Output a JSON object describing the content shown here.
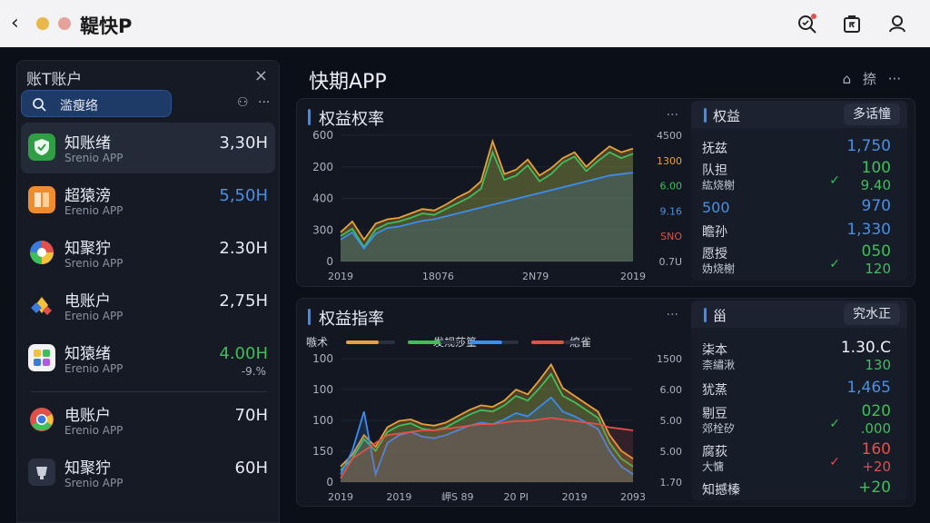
{
  "titlebar": {
    "back_glyph": "‹",
    "title": "鞮快P",
    "icons": [
      "search-alert-icon",
      "bag-icon",
      "user-icon"
    ]
  },
  "left": {
    "header": "账T账户",
    "close_glyph": "×",
    "search": {
      "text": "滥瘦络"
    },
    "tools": [
      "⚇",
      "···"
    ],
    "accounts": [
      {
        "name": "知账绪",
        "sub": "Srenio APP",
        "value": "3,30H",
        "color": "#e6e9ef",
        "icon": "shield-green-icon"
      },
      {
        "name": "超猿滂",
        "sub": "Erenio APP",
        "value": "5,50H",
        "color": "#4a90e2",
        "icon": "book-orange-icon"
      },
      {
        "name": "知聚狞",
        "sub": "Srenio APP",
        "value": "2.30H",
        "color": "#e6e9ef",
        "icon": "pinwheel-icon"
      },
      {
        "name": "电账户",
        "sub": "Erenio APP",
        "value": "2,75H",
        "color": "#e6e9ef",
        "icon": "diamond-icon"
      },
      {
        "name": "知猿绪",
        "sub": "Erenio APP",
        "value": "4.00H",
        "change": "-9.%",
        "color": "#3fbf5a",
        "icon": "photo-icon"
      },
      {
        "name": "电账户",
        "sub": "Erenio APP",
        "value": "70H",
        "color": "#e6e9ef",
        "icon": "chrome-icon"
      },
      {
        "name": "知聚狞",
        "sub": "Srenio APP",
        "value": "60H",
        "color": "#e6e9ef",
        "icon": "cup-icon"
      }
    ]
  },
  "main": {
    "title": "快期APP",
    "tools": [
      "⌂",
      "捺",
      "···"
    ],
    "chart1": {
      "title": "权益权率",
      "more": "···",
      "side": {
        "title": "权益",
        "button": "多话憧",
        "rows": [
          {
            "label": "抚兹",
            "value": "1,750"
          },
          {
            "label": "队担",
            "label2": "紘烧榭",
            "value": "100",
            "value2": "9.40",
            "mark": "✓"
          },
          {
            "label": "500",
            "value": "970"
          },
          {
            "label": "瞻孙",
            "value": "1,330"
          },
          {
            "label": "愿授",
            "label2": "妫烧榭",
            "value": "050",
            "value2": "120",
            "mark": "✓"
          }
        ]
      }
    },
    "chart2": {
      "title": "权益指率",
      "more": "···",
      "legend": [
        "嗾术",
        "发规莎篁",
        "熄雀"
      ],
      "side": {
        "title": "甾",
        "button": "究水正",
        "rows": [
          {
            "label": "柒本",
            "label2": "柰繡湫",
            "value": "1.30.C",
            "value2": "130"
          },
          {
            "label": "犹蒸",
            "value": "1,465"
          },
          {
            "label": "剔豆",
            "label2": "郊栓矽",
            "value": "020",
            "value2": ".000",
            "mark": "✓"
          },
          {
            "label": "腐荻",
            "label2": "大慵",
            "value": "160",
            "value2": "+20",
            "mark": "✓"
          },
          {
            "label": "知撼榛",
            "value": "+20"
          }
        ]
      }
    }
  },
  "chart_data": [
    {
      "type": "area",
      "title": "权益权率",
      "y_left_ticks": [
        "600",
        "200",
        "400",
        "300",
        "0"
      ],
      "y_right_ticks": [
        "4500",
        "1300",
        "6.00",
        "9.16",
        "SNO",
        "0.7U"
      ],
      "x_ticks": [
        "2019",
        "18076",
        "2N79",
        "2019"
      ],
      "series": [
        {
          "color": "#e8a23a",
          "values": [
            40,
            55,
            30,
            52,
            58,
            60,
            66,
            72,
            70,
            78,
            88,
            96,
            110,
            165,
            120,
            126,
            140,
            118,
            128,
            142,
            150,
            130,
            145,
            158,
            150,
            155
          ]
        },
        {
          "color": "#3fbf5a",
          "values": [
            35,
            45,
            20,
            44,
            52,
            55,
            60,
            66,
            64,
            72,
            80,
            88,
            100,
            150,
            112,
            118,
            132,
            110,
            120,
            136,
            144,
            124,
            138,
            150,
            142,
            148
          ]
        },
        {
          "color": "#3d8df0",
          "values": [
            30,
            40,
            18,
            38,
            46,
            48,
            52,
            56,
            58,
            62,
            66,
            70,
            74,
            78,
            82,
            86,
            90,
            94,
            98,
            102,
            106,
            110,
            114,
            118,
            120,
            122
          ]
        }
      ]
    },
    {
      "type": "area",
      "title": "权益指率",
      "y_left_ticks": [
        "100",
        "100",
        "100",
        "150",
        "0"
      ],
      "y_right_ticks": [
        "1500",
        "6.00",
        "5.00",
        "5.00",
        "1.70"
      ],
      "x_ticks": [
        "2019",
        "2019",
        "岬S 89",
        "20 PI",
        "2019",
        "2093"
      ],
      "series": [
        {
          "color": "#e8a23a",
          "values": [
            20,
            35,
            60,
            45,
            70,
            78,
            80,
            74,
            72,
            76,
            84,
            92,
            98,
            96,
            104,
            118,
            112,
            130,
            150,
            120,
            110,
            100,
            90,
            60,
            40,
            30
          ]
        },
        {
          "color": "#3fbf5a",
          "values": [
            15,
            30,
            55,
            40,
            64,
            72,
            75,
            68,
            66,
            70,
            78,
            86,
            92,
            90,
            98,
            110,
            104,
            120,
            138,
            110,
            102,
            92,
            82,
            50,
            30,
            20
          ]
        },
        {
          "color": "#3d8df0",
          "values": [
            10,
            40,
            90,
            10,
            50,
            60,
            64,
            58,
            56,
            60,
            66,
            72,
            76,
            74,
            80,
            88,
            84,
            96,
            108,
            90,
            84,
            76,
            68,
            40,
            20,
            10
          ]
        },
        {
          "color": "#e2504a",
          "values": [
            5,
            30,
            40,
            50,
            60,
            62,
            64,
            66,
            66,
            68,
            70,
            72,
            74,
            74,
            76,
            78,
            78,
            80,
            82,
            80,
            78,
            76,
            74,
            70,
            68,
            66
          ]
        }
      ]
    }
  ]
}
